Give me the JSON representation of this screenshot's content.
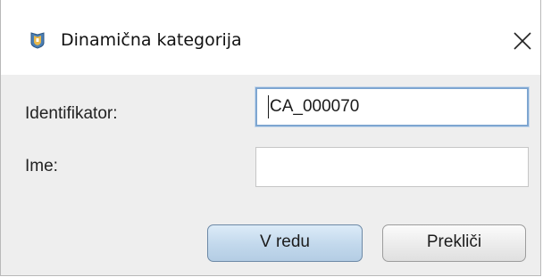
{
  "dialog": {
    "title": "Dinamična kategorija",
    "app_icon": "category-shield-icon",
    "close_icon": "close-icon"
  },
  "form": {
    "identifier_label": "Identifikator:",
    "identifier_value": "CA_000070",
    "name_label": "Ime:",
    "name_value": ""
  },
  "buttons": {
    "ok_label": "V redu",
    "cancel_label": "Prekliči"
  },
  "colors": {
    "content_background": "#eeeeee",
    "focus_border": "#7ea6d1",
    "ok_button": "#c2d8ec"
  }
}
